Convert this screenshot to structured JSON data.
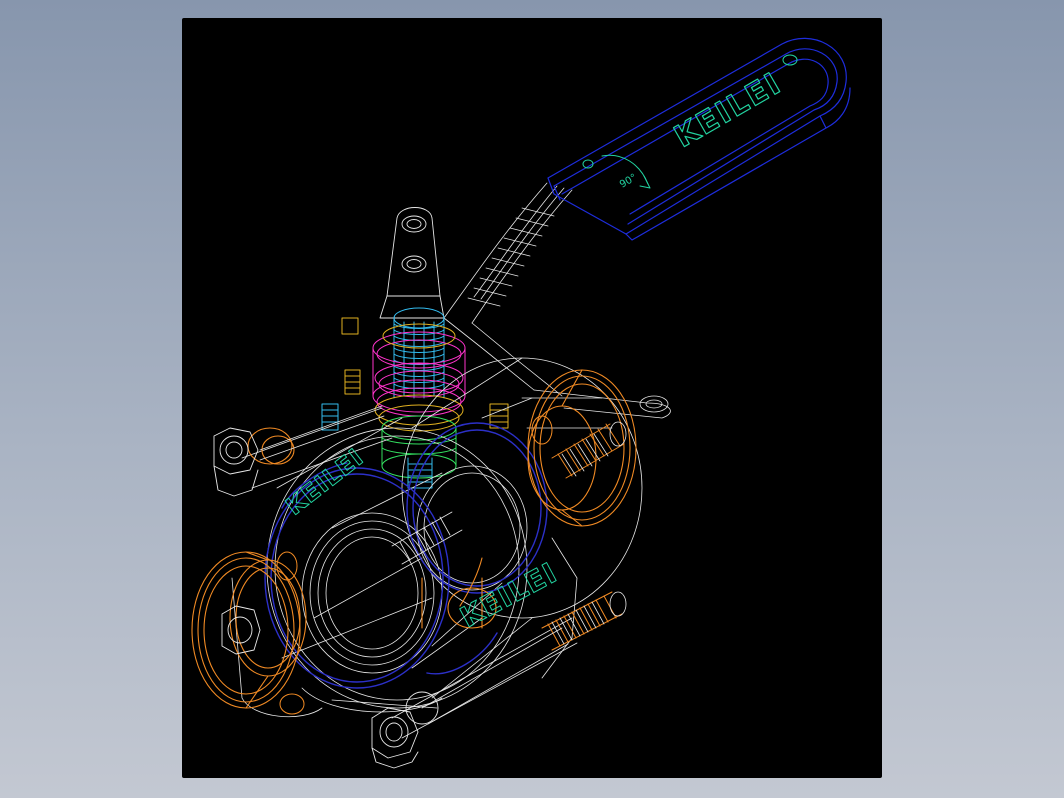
{
  "drawing": {
    "background": "#000000",
    "page_background": "#9aa6b8",
    "handle_brand": "KEILEI",
    "body_brand_front": "KEILEI",
    "body_brand_side": "KEILEI",
    "angle_mark": "90°",
    "colors": {
      "outline": "#e8e8e8",
      "handle": "#1e2ddc",
      "brand_text": "#22d3a0",
      "stem": "#33bbee",
      "packing": "#ff33cc",
      "clamp": "#f08a24",
      "gland": "#d8a820",
      "seat": "#2c30c8",
      "sleeve": "#33e060"
    }
  }
}
